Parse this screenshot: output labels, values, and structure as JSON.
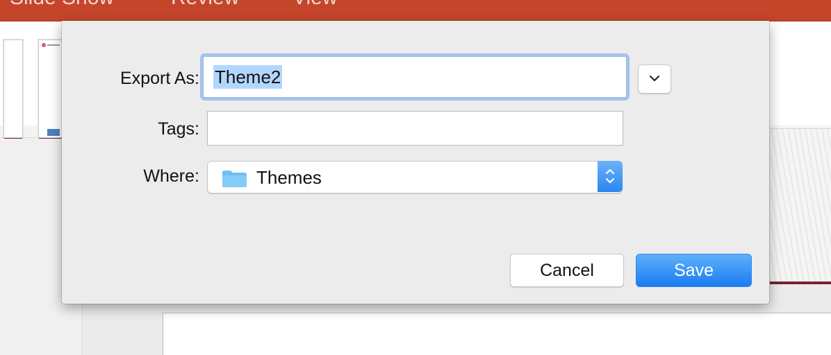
{
  "ribbon": {
    "tabs": [
      "Slide Show",
      "Review",
      "View"
    ]
  },
  "dialog": {
    "export_as_label": "Export As:",
    "export_as_value": "Theme2",
    "tags_label": "Tags:",
    "tags_value": "",
    "where_label": "Where:",
    "where_value": "Themes",
    "cancel_label": "Cancel",
    "save_label": "Save"
  },
  "colors": {
    "ribbon": "#c4452a",
    "accent": "#1a7cf2",
    "selection": "#b2d7ff"
  }
}
